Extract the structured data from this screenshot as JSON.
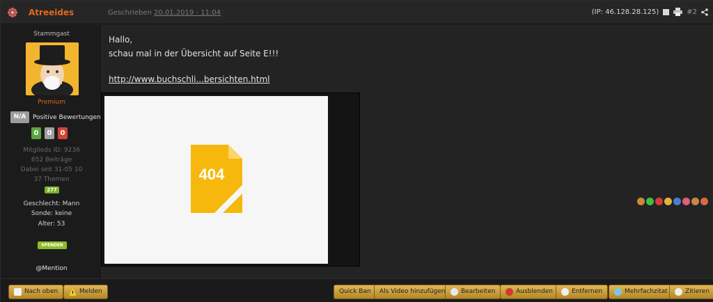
{
  "header": {
    "author": "Atreeides",
    "written_label": "Geschrieben",
    "date": "20.01.2019 - 11:04",
    "ip": "(IP: 46.128.28.125)",
    "post_number": "#2"
  },
  "sidebar": {
    "rank": "Stammgast",
    "membership": "Premium",
    "rating_badge": "N/A",
    "rating_label": "Positive Bewertungen",
    "votes": [
      "0",
      "0",
      "0"
    ],
    "stats": [
      "Mitglieds ID: 9236",
      "652 Beiträge",
      "Dabei seit 31-05 10",
      "37 Themen"
    ],
    "level_badge": "277",
    "info": [
      "Geschlecht: Mann",
      "Sonde: keine",
      "Alter: 53"
    ],
    "spender_badge": "SPENDER",
    "mention": "@Mention"
  },
  "content": {
    "line1": "Hallo,",
    "line2": "schau mal in der Übersicht auf Seite E!!!",
    "link": "http://www.buchschli...bersichten.html",
    "error_code": "404"
  },
  "reactions": [
    "thumbs-up-icon",
    "check-icon",
    "x-icon",
    "smile-icon",
    "info-icon",
    "heart-icon",
    "wrench-icon",
    "alarm-icon"
  ],
  "footer": {
    "left": [
      {
        "label": "Nach oben",
        "icon": "document-icon"
      },
      {
        "label": "Melden",
        "icon": "warning-icon"
      }
    ],
    "right": [
      {
        "label": "Quick Ban"
      },
      {
        "label": "Als Video hinzufügen"
      },
      {
        "label": "Bearbeiten",
        "icon": "edit-icon"
      },
      {
        "label": "Ausblenden",
        "icon": "hide-icon"
      },
      {
        "label": "Entfernen",
        "icon": "remove-icon"
      },
      {
        "label": "Mehrfachzitat",
        "icon": "multiquote-icon"
      },
      {
        "label": "Zitieren",
        "icon": "quote-icon"
      }
    ]
  },
  "colors": {
    "accent_orange": "#e2661e",
    "button_gold": "#c9a040",
    "vote_green": "#59a53d",
    "vote_grey": "#9f9f9f",
    "vote_red": "#d24538",
    "error_yellow": "#f6b80c"
  }
}
